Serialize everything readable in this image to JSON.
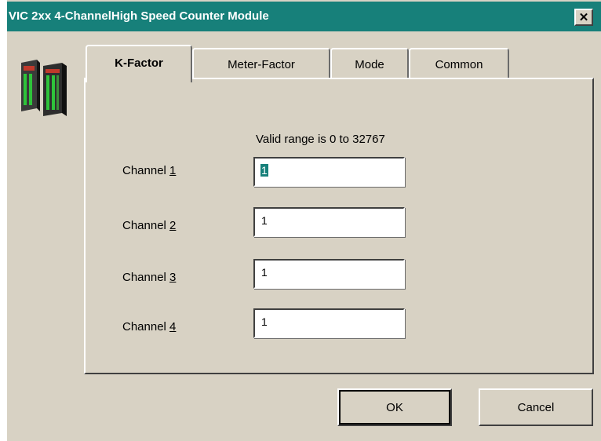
{
  "window": {
    "title": "VIC 2xx 4-ChannelHigh Speed Counter Module",
    "close_glyph": "✕"
  },
  "tabs": [
    {
      "label": "K-Factor",
      "active": true
    },
    {
      "label": "Meter-Factor",
      "active": false
    },
    {
      "label": "Mode",
      "active": false
    },
    {
      "label": "Common",
      "active": false
    }
  ],
  "panel": {
    "valid_range": "Valid range is 0 to 32767",
    "channels": [
      {
        "prefix": "Channel ",
        "accel": "1",
        "value": "1"
      },
      {
        "prefix": "Channel ",
        "accel": "2",
        "value": "1"
      },
      {
        "prefix": "Channel ",
        "accel": "3",
        "value": "1"
      },
      {
        "prefix": "Channel ",
        "accel": "4",
        "value": "1"
      }
    ]
  },
  "buttons": {
    "ok": "OK",
    "cancel": "Cancel"
  },
  "colors": {
    "titlebar": "#17807a",
    "face": "#d8d2c4",
    "selection": "#17807a",
    "led_green": "#2ec43a",
    "led_red": "#d23a2a"
  },
  "icons": {
    "module": "plc-module-icon",
    "close": "close-icon"
  }
}
